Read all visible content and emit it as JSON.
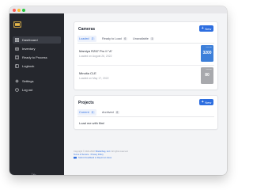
{
  "app": {
    "colors": {
      "accent": "#2d6ee0",
      "sidebar": "#25272d",
      "background": "#f3f4f6"
    }
  },
  "sidebar": {
    "logo_icon": "film-frame-icon",
    "items": [
      {
        "label": "Dashboard",
        "icon": "grid-icon",
        "active": true
      },
      {
        "label": "Inventory",
        "icon": "camera-icon",
        "active": false
      },
      {
        "label": "Ready to Process",
        "icon": "list-icon",
        "active": false
      },
      {
        "label": "Logbook",
        "icon": "book-icon",
        "active": false
      },
      {
        "label": "Settings",
        "icon": "gear-icon",
        "active": false
      },
      {
        "label": "Log out",
        "icon": "logout-icon",
        "active": false
      }
    ],
    "collapse_icon": "collapse-icon"
  },
  "cameras": {
    "title": "Cameras",
    "new_label": "New",
    "tabs": [
      {
        "label": "Loaded",
        "count": "2",
        "active": true
      },
      {
        "label": "Ready to Load",
        "count": "0",
        "active": false
      },
      {
        "label": "Unavailable",
        "count": "1",
        "active": false
      }
    ],
    "rows": [
      {
        "name": "Mamiya RZ67 Pro II \"A\"",
        "date": "Loaded on August 26, 2022",
        "thumb_text": "3200",
        "thumb_brand": "ILFORD",
        "thumb_color": "#3d7fd9"
      },
      {
        "name": "Minolta CLE",
        "date": "Loaded on May 17, 2022",
        "thumb_text": "80",
        "thumb_brand": "ILFORD",
        "thumb_color": "#a8a9ad"
      }
    ]
  },
  "projects": {
    "title": "Projects",
    "new_label": "New",
    "tabs": [
      {
        "label": "Current",
        "count": "0",
        "active": true
      },
      {
        "label": "Archived",
        "count": "0",
        "active": false
      }
    ],
    "empty_message": "Load me with film!"
  },
  "footer": {
    "copyright_prefix": "Copyright © 2021-2022",
    "copyright_link": "Shutterbug, LLC",
    "copyright_suffix": ". All rights reserved.",
    "terms_label": "Terms of Service",
    "privacy_label": "Privacy Policy",
    "feedback_label": "Submit Feedback or Report an Issue",
    "feedback_icon": "chat-icon"
  }
}
